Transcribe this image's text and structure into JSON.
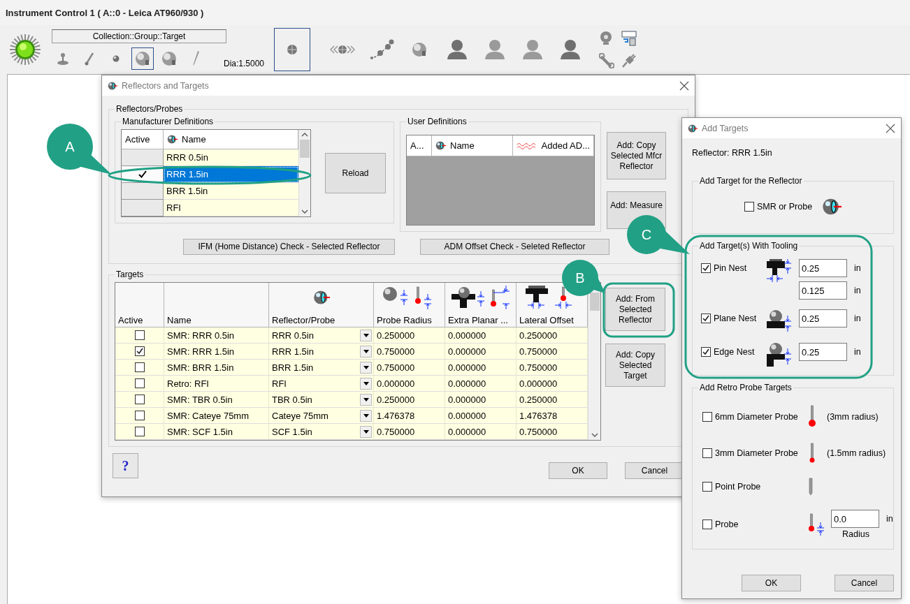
{
  "window": {
    "title": "Instrument Control 1 ( A::0 - Leica AT960/930 )"
  },
  "toolbar": {
    "target_path": "Collection::Group::Target",
    "diameter": "Dia:1.5000",
    "nest_tools": [
      {
        "kind": "joystick",
        "selected": false
      },
      {
        "kind": "probe",
        "selected": false
      },
      {
        "kind": "small-sphere",
        "selected": false
      },
      {
        "kind": "sphere",
        "selected": true
      },
      {
        "kind": "sphere",
        "selected": false
      },
      {
        "kind": "pen",
        "selected": false
      }
    ],
    "big_tool": {
      "kind": "crosshair",
      "selected": true
    },
    "main_tools": [
      {
        "kind": "arrows",
        "selected": false
      },
      {
        "kind": "path",
        "selected": false
      },
      {
        "kind": "sphere",
        "selected": false
      },
      {
        "kind": "person-dark",
        "selected": false
      },
      {
        "kind": "person",
        "selected": false
      },
      {
        "kind": "person",
        "selected": false
      },
      {
        "kind": "person-dark",
        "selected": false
      }
    ],
    "corner_tools": [
      {
        "kind": "webcam",
        "selected": false
      },
      {
        "kind": "screen",
        "selected": false
      },
      {
        "kind": "wrench",
        "selected": false
      },
      {
        "kind": "plug",
        "selected": false
      }
    ]
  },
  "reflectors_dialog": {
    "title": "Reflectors and Targets",
    "group_title": "Reflectors/Probes",
    "manufacturer": {
      "title": "Manufacturer Definitions",
      "columns": [
        "Active",
        "Name"
      ],
      "rows": [
        {
          "name": "RRR 0.5in",
          "active": false,
          "selected": false
        },
        {
          "name": "RRR 1.5in",
          "active": true,
          "selected": true
        },
        {
          "name": "BRR 1.5in",
          "active": false,
          "selected": false
        },
        {
          "name": "RFI",
          "active": false,
          "selected": false
        }
      ]
    },
    "reload": "Reload",
    "user": {
      "title": "User Definitions",
      "columns": [
        {
          "label": "A...",
          "kind": "plain"
        },
        {
          "label": "Name",
          "kind": "reflector"
        },
        {
          "label": "Added AD...",
          "kind": "wave"
        }
      ]
    },
    "side_buttons": [
      "Add: Copy Selected Mfcr Reflector",
      "Add: Measure"
    ],
    "check_buttons": [
      "IFM (Home Distance) Check - Selected Reflector",
      "ADM Offset Check - Seleted Reflector"
    ],
    "targets": {
      "title": "Targets",
      "columns": [
        {
          "label": "Active",
          "kind": "plain"
        },
        {
          "label": "Name",
          "kind": "plain"
        },
        {
          "label": "Reflector/Probe",
          "kind": "reflector"
        },
        {
          "label": "Probe Radius",
          "kind": "radius"
        },
        {
          "label": "Extra Planar ...",
          "kind": "planar"
        },
        {
          "label": "Lateral Offset",
          "kind": "lateral"
        }
      ],
      "rows": [
        {
          "active": false,
          "name": "SMR: RRR 0.5in",
          "reflector": "RRR 0.5in",
          "radius": "0.250000",
          "planar": "0.000000",
          "lateral": "0.250000"
        },
        {
          "active": true,
          "name": "SMR: RRR 1.5in",
          "reflector": "RRR 1.5in",
          "radius": "0.750000",
          "planar": "0.000000",
          "lateral": "0.750000"
        },
        {
          "active": false,
          "name": "SMR: BRR 1.5in",
          "reflector": "BRR 1.5in",
          "radius": "0.750000",
          "planar": "0.000000",
          "lateral": "0.750000"
        },
        {
          "active": false,
          "name": "Retro: RFI",
          "reflector": "RFI",
          "radius": "0.000000",
          "planar": "0.000000",
          "lateral": "0.000000"
        },
        {
          "active": false,
          "name": "SMR: TBR 0.5in",
          "reflector": "TBR 0.5in",
          "radius": "0.250000",
          "planar": "0.000000",
          "lateral": "0.250000"
        },
        {
          "active": false,
          "name": "SMR: Cateye 75mm",
          "reflector": "Cateye 75mm",
          "radius": "1.476378",
          "planar": "0.000000",
          "lateral": "1.476378"
        },
        {
          "active": false,
          "name": "SMR: SCF 1.5in",
          "reflector": "SCF 1.5in",
          "radius": "0.750000",
          "planar": "0.000000",
          "lateral": "0.750000"
        }
      ]
    },
    "target_buttons": [
      "Add: From Selected Reflector",
      "Add: Copy Selected Target"
    ],
    "help": "?",
    "ok": "OK",
    "cancel": "Cancel"
  },
  "add_targets_dialog": {
    "title": "Add Targets",
    "reflector": "Reflector: RRR 1.5in",
    "smr_group": "Add Target for the Reflector",
    "smr": {
      "label": "SMR or Probe",
      "checked": false
    },
    "tooling_group": "Add Target(s) With Tooling",
    "tooling": [
      {
        "kind": "pin",
        "label": "Pin Nest",
        "checked": true,
        "fields": [
          {
            "value": "0.25",
            "unit": "in"
          },
          {
            "value": "0.125",
            "unit": "in"
          }
        ]
      },
      {
        "kind": "plane",
        "label": "Plane Nest",
        "checked": true,
        "fields": [
          {
            "value": "0.25",
            "unit": "in"
          }
        ]
      },
      {
        "kind": "edge",
        "label": "Edge Nest",
        "checked": true,
        "fields": [
          {
            "value": "0.25",
            "unit": "in"
          }
        ]
      }
    ],
    "retro_group": "Add Retro Probe Targets",
    "retro": [
      {
        "kind": "large-ball",
        "label": "6mm Diameter Probe",
        "checked": false,
        "note": "(3mm radius)"
      },
      {
        "kind": "small-ball",
        "label": "3mm Diameter Probe",
        "checked": false,
        "note": "(1.5mm radius)"
      },
      {
        "kind": "point",
        "label": "Point Probe",
        "checked": false
      },
      {
        "kind": "custom",
        "label": "Probe",
        "checked": false,
        "value": "0.0",
        "unit": "in",
        "caption": "Radius"
      }
    ],
    "ok": "OK",
    "cancel": "Cancel"
  },
  "callouts": [
    {
      "label": "A"
    },
    {
      "label": "B"
    },
    {
      "label": "C"
    }
  ]
}
